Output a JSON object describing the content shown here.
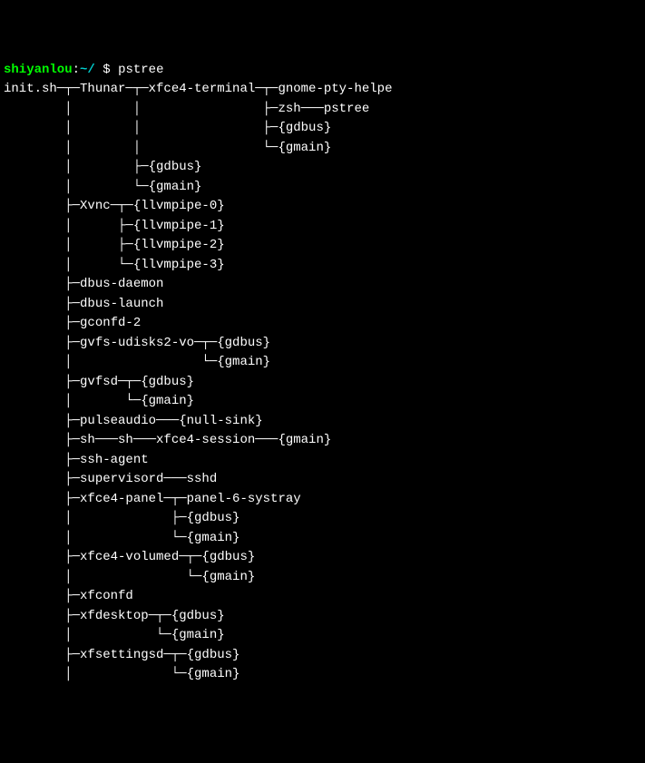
{
  "prompt": {
    "user": "shiyanlou",
    "separator": ":",
    "path": "~/",
    "symbol": " $ ",
    "command": "pstree"
  },
  "tree": [
    "init.sh─┬─Thunar─┬─xfce4-terminal─┬─gnome-pty-helpe",
    "        │        │                ├─zsh───pstree",
    "        │        │                ├─{gdbus}",
    "        │        │                └─{gmain}",
    "        │        ├─{gdbus}",
    "        │        └─{gmain}",
    "        ├─Xvnc─┬─{llvmpipe-0}",
    "        │      ├─{llvmpipe-1}",
    "        │      ├─{llvmpipe-2}",
    "        │      └─{llvmpipe-3}",
    "        ├─dbus-daemon",
    "        ├─dbus-launch",
    "        ├─gconfd-2",
    "        ├─gvfs-udisks2-vo─┬─{gdbus}",
    "        │                 └─{gmain}",
    "        ├─gvfsd─┬─{gdbus}",
    "        │       └─{gmain}",
    "        ├─pulseaudio───{null-sink}",
    "        ├─sh───sh───xfce4-session───{gmain}",
    "        ├─ssh-agent",
    "        ├─supervisord───sshd",
    "        ├─xfce4-panel─┬─panel-6-systray",
    "        │             ├─{gdbus}",
    "        │             └─{gmain}",
    "        ├─xfce4-volumed─┬─{gdbus}",
    "        │               └─{gmain}",
    "        ├─xfconfd",
    "        ├─xfdesktop─┬─{gdbus}",
    "        │           └─{gmain}",
    "        ├─xfsettingsd─┬─{gdbus}",
    "        │             └─{gmain}"
  ]
}
